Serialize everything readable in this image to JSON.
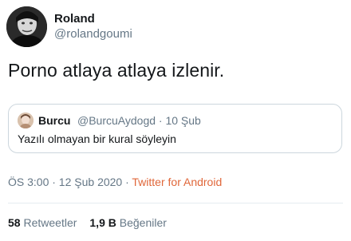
{
  "author": {
    "name": "Roland",
    "handle": "@rolandgoumi",
    "avatar_icon": "user-avatar-photo"
  },
  "tweet": {
    "text": "Porno atlaya atlaya izlenir."
  },
  "quoted_tweet": {
    "name": "Burcu",
    "meta": "@BurcuAydogd · 10 Şub",
    "text": "Yazılı olmayan bir kural söyleyin",
    "avatar_icon": "user-avatar-photo"
  },
  "timestamp": {
    "time_date": "ÖS 3:00 · 12 Şub 2020 · ",
    "source": "Twitter for Android"
  },
  "stats": {
    "retweets_count": "58",
    "retweets_label": "Retweetler",
    "likes_count": "1,9 B",
    "likes_label": "Beğeniler"
  },
  "colors": {
    "text_primary": "#14171a",
    "text_secondary": "#657786",
    "source_link": "#e0673a",
    "border": "#ccd6dd"
  }
}
